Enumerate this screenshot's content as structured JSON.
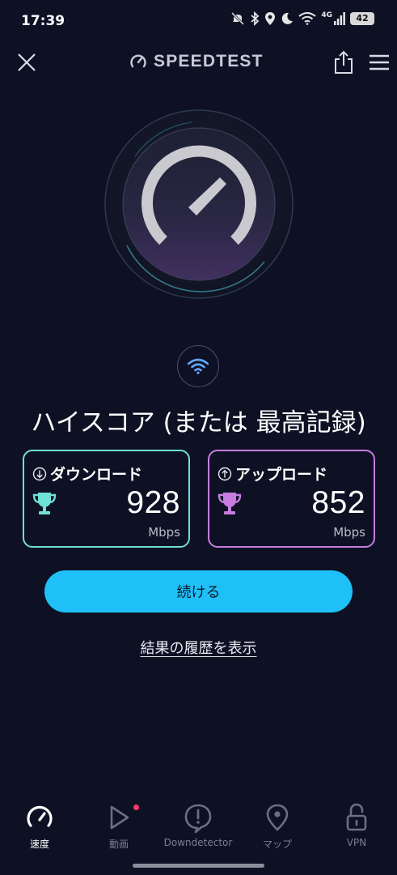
{
  "status_bar": {
    "time": "17:39",
    "network": "4G",
    "battery": "42"
  },
  "header": {
    "brand": "SPEEDTEST"
  },
  "result": {
    "headline": "ハイスコア (または 最高記録)",
    "download": {
      "label": "ダウンロード",
      "value": "928",
      "unit": "Mbps"
    },
    "upload": {
      "label": "アップロード",
      "value": "852",
      "unit": "Mbps"
    }
  },
  "actions": {
    "continue_label": "続ける",
    "history_link": "結果の履歴を表示"
  },
  "bottom_nav": [
    {
      "label": "速度",
      "icon": "speed-gauge-icon",
      "active": true
    },
    {
      "label": "動画",
      "icon": "play-icon",
      "active": false
    },
    {
      "label": "Downdetector",
      "icon": "alert-icon",
      "active": false
    },
    {
      "label": "マップ",
      "icon": "map-pin-icon",
      "active": false
    },
    {
      "label": "VPN",
      "icon": "unlock-icon",
      "active": false
    }
  ],
  "colors": {
    "background": "#0e1124",
    "download_accent": "#6fe0d6",
    "upload_accent": "#c77de0",
    "button": "#1fc0f7"
  }
}
